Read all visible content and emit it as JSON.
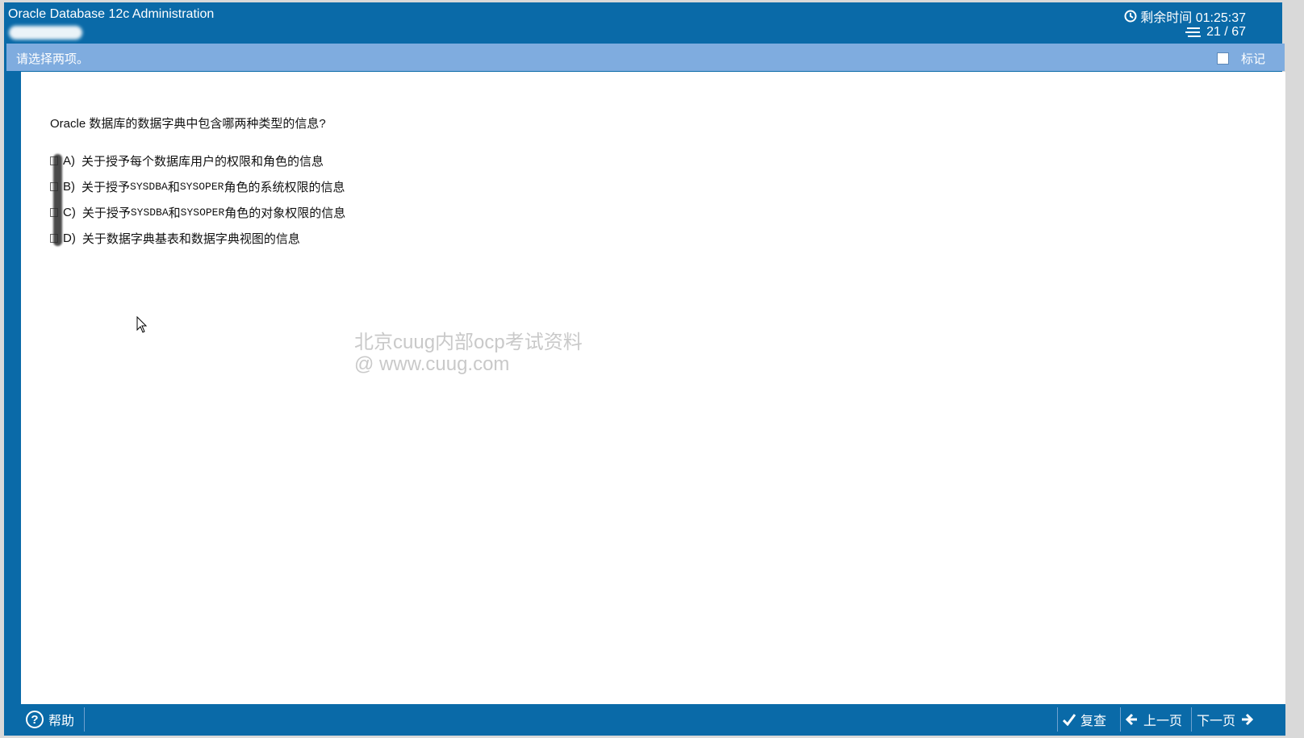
{
  "header": {
    "app_title": "Oracle Database 12c Administration",
    "timer_label": "剩余时间 01:25:37",
    "progress": "21 / 67"
  },
  "instruction": {
    "text": "请选择两项。",
    "mark_label": "标记"
  },
  "question": {
    "text": "Oracle 数据库的数据字典中包含哪两种类型的信息?",
    "options": [
      {
        "letter": "A)",
        "parts": [
          "关于授予每个数据库用户的权限和角色的信息"
        ]
      },
      {
        "letter": "B)",
        "parts": [
          "关于授予 ",
          "SYSDBA",
          " 和 ",
          "SYSOPER",
          " 角色的系统权限的信息"
        ]
      },
      {
        "letter": "C)",
        "parts": [
          "关于授予 ",
          "SYSDBA",
          " 和 ",
          "SYSOPER",
          " 角色的对象权限的信息"
        ]
      },
      {
        "letter": "D)",
        "parts": [
          "关于数据字典基表和数据字典视图的信息"
        ]
      }
    ]
  },
  "watermark": {
    "line1": "北京cuug内部ocp考试资料",
    "line2": "@ www.cuug.com"
  },
  "footer": {
    "help_label": "帮助",
    "review_label": "复查",
    "prev_label": "上一页",
    "next_label": "下一页"
  },
  "icons": {
    "clock": "clock-icon",
    "progress": "list-icon",
    "help": "help-icon",
    "review": "checkmark-icon",
    "prev": "arrow-left-icon",
    "next": "arrow-right-icon"
  },
  "colors": {
    "primary": "#0a6aa8",
    "instruction_bar": "#7facdf",
    "content_bg": "#ffffff",
    "watermark": "#c9c9c9"
  }
}
